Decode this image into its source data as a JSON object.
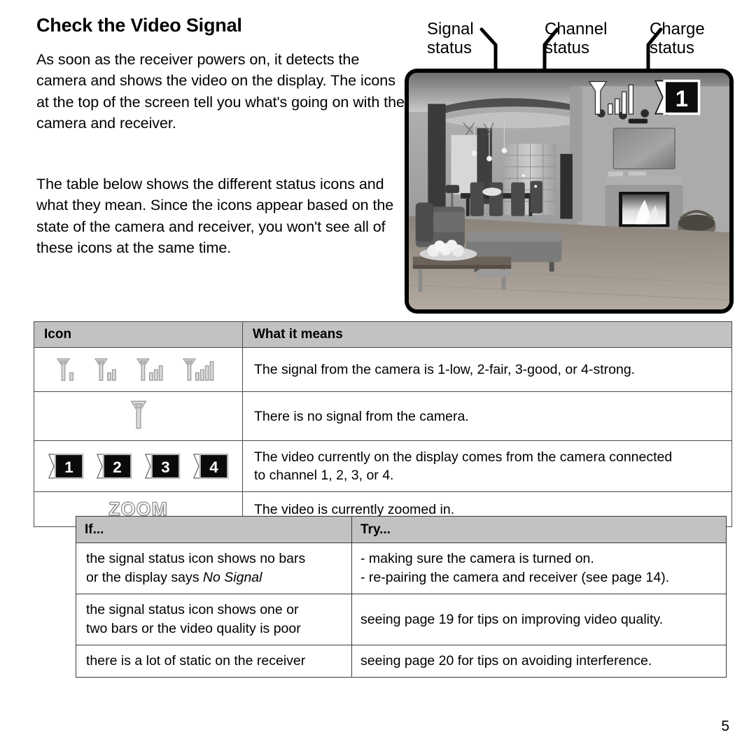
{
  "document": {
    "title": "Check the Video Signal",
    "page_number": "5",
    "paragraphs": [
      "As soon as the receiver powers on, it detects the camera and shows the video on the display. The icons at the top of the screen tell you what's going on with the camera and receiver.",
      "The table below shows the different status icons and what they mean. Since the icons appear based on the state of the camera and receiver, you won't see all of these icons at the same time."
    ]
  },
  "callouts": [
    {
      "id": "signal-status",
      "label": "Signal\nstatus"
    },
    {
      "id": "channel-status",
      "label": "Channel\nstatus"
    },
    {
      "id": "charge-status",
      "label": "Charge\nstatus"
    }
  ],
  "screen": {
    "description": "Grayscale photo of a living room with fireplace, wall-mounted TV, sofa, ottoman, coffee table and dining area",
    "osd_icons": [
      {
        "id": "signal-bars-icon",
        "bars": 4
      },
      {
        "id": "channel-number-icon",
        "channel": "1"
      },
      {
        "id": "charge-plug-icon"
      }
    ]
  },
  "icon_table": {
    "headers": [
      "Icon",
      "What it means"
    ],
    "rows": [
      {
        "icon_type": "signal-bars",
        "icon_values": [
          "1",
          "2",
          "3",
          "4"
        ],
        "meaning": "The signal from the camera is 1-low, 2-fair, 3-good, or 4-strong."
      },
      {
        "icon_type": "no-signal",
        "icon_values": [
          "0"
        ],
        "meaning": "There is no signal from the camera."
      },
      {
        "icon_type": "channel",
        "icon_values": [
          "1",
          "2",
          "3",
          "4"
        ],
        "meaning_lines": [
          "The video currently on the display comes from the camera connected",
          "to channel 1, 2, 3, or 4."
        ]
      },
      {
        "icon_type": "zoom-word",
        "icon_values": [
          "ZOOM"
        ],
        "meaning": "The video is currently zoomed in."
      }
    ]
  },
  "tips_table": {
    "headers": [
      "If...",
      "Try..."
    ],
    "rows": [
      {
        "if_lines": [
          "the signal status icon shows no bars",
          "or the display says "
        ],
        "if_italic_tail": "No Signal",
        "try_lines": [
          "- making sure the camera is turned on.",
          "- re-pairing the camera and receiver (see page 14)."
        ]
      },
      {
        "if_lines": [
          "the signal status icon shows one or",
          "two bars or the video quality is poor"
        ],
        "if_italic_tail": "",
        "try_lines": [
          "seeing page 19 for tips on improving video quality."
        ]
      },
      {
        "if_lines": [
          "there is a lot of static on the receiver"
        ],
        "if_italic_tail": "",
        "try_lines": [
          "seeing page 20 for tips on avoiding interference."
        ]
      }
    ]
  },
  "colors": {
    "header_gray": "#c2c2c2",
    "border_gray": "#4a4a4a",
    "icon_gray": "#b5b5b5",
    "text_black": "#000000"
  }
}
